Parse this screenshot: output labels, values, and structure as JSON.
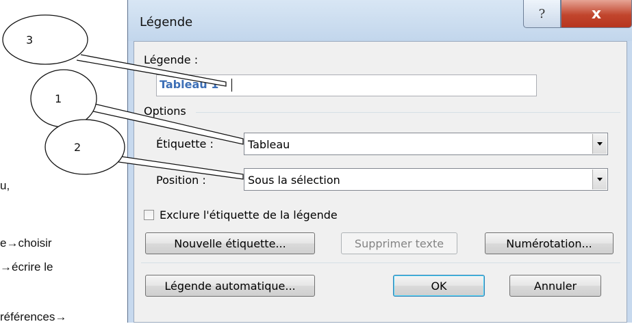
{
  "document": {
    "fragments": [
      "u,",
      "e→choisir",
      "→écrire le",
      "références→"
    ]
  },
  "callouts": [
    "3",
    "1",
    "2"
  ],
  "dialog": {
    "title": "Légende",
    "help_glyph": "?",
    "close_glyph": "x",
    "caption_label": "Légende :",
    "caption_value": "Tableau 1",
    "options_label": "Options",
    "etiquette_label": "Étiquette :",
    "etiquette_value": "Tableau",
    "position_label": "Position :",
    "position_value": "Sous la sélection",
    "exclude_label": "Exclure l'étiquette de la légende",
    "exclude_checked": false,
    "new_label_button": "Nouvelle étiquette...",
    "delete_button": "Supprimer texte",
    "numbering_button": "Numérotation...",
    "auto_caption_button": "Légende automatique...",
    "ok_button": "OK",
    "cancel_button": "Annuler"
  },
  "colors": {
    "frame": "#c7d9ee",
    "client": "#f0f0f0",
    "close_button": "#c1452d",
    "caption_text": "#3d6fb6"
  }
}
